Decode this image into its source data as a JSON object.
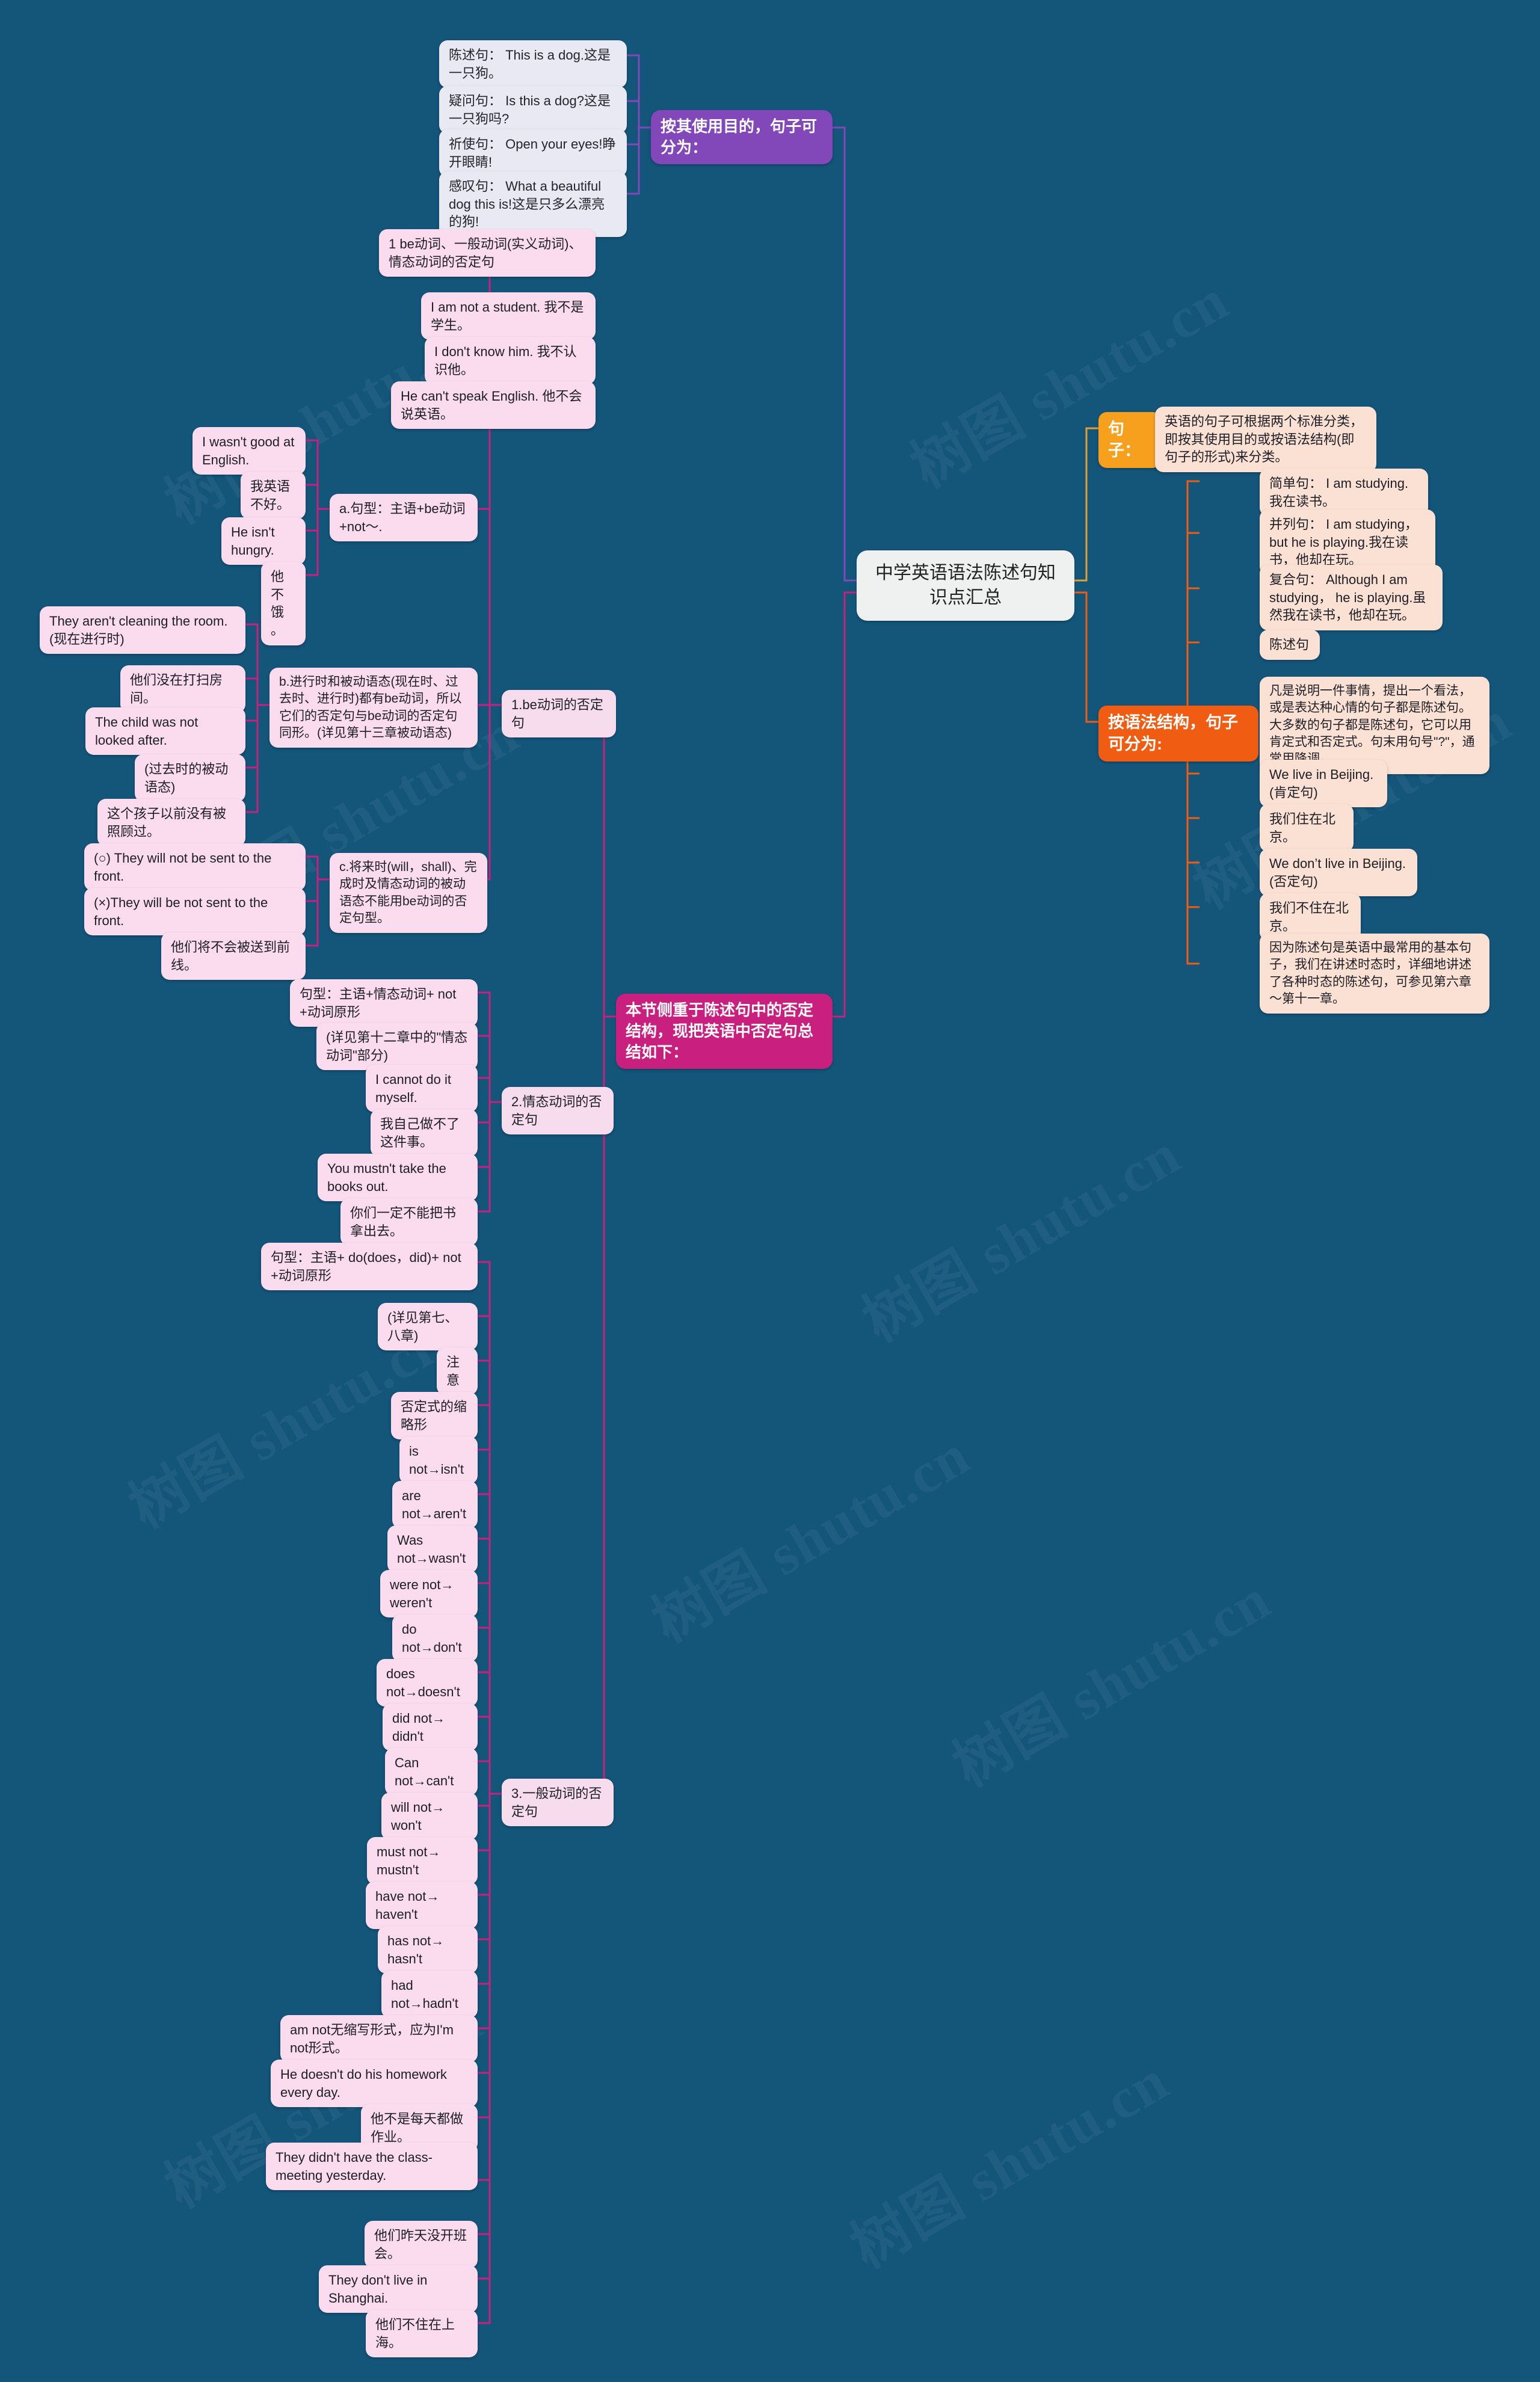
{
  "meta": {
    "watermark": "树图 shutu.cn",
    "background_color": "#14557a"
  },
  "root": {
    "label": "中学英语语法陈述句知识点汇总"
  },
  "branches": {
    "purpose": {
      "label": "按其使用目的，句子可分为：",
      "color": "#8247b8",
      "items": [
        "陈述句：  This is a dog.这是一只狗。",
        "疑问句：  Is this a dog?这是一只狗吗?",
        "祈使句：  Open your eyes!睁开眼睛!",
        "感叹句：  What a beautiful dog this is!这是只多么漂亮的狗!"
      ]
    },
    "negation_intro": {
      "label": "本节侧重于陈述句中的否定结构，现把英语中否定句总结如下：",
      "color": "#c9207f"
    },
    "be_negation": {
      "label": "1.be动词的否定句",
      "color": "#c9207f",
      "head_items": [
        "1 be动词、一般动词(实义动词)、情态动词的否定句",
        "I am not a student. 我不是学生。",
        "I don't know him. 我不认识他。",
        "He can't speak English. 他不会说英语。"
      ],
      "sub_a": {
        "label": "a.句型：主语+be动词+not～.",
        "items": [
          "I wasn't good at English.",
          "我英语不好。",
          "He isn't hungry.",
          "他不饿。"
        ]
      },
      "sub_b": {
        "label": "b.进行时和被动语态(现在时、过去时、进行时)都有be动词，所以它们的否定句与be动词的否定句同形。(详见第十三章被动语态)",
        "items": [
          "They aren't cleaning the room.(现在进行时)",
          "他们没在打扫房间。",
          "The child was not looked after.",
          "(过去时的被动语态)",
          "这个孩子以前没有被照顾过。"
        ]
      },
      "sub_c": {
        "label": "c.将来时(will，shall)、完成时及情态动词的被动语态不能用be动词的否定句型。",
        "items": [
          "(○) They will not be sent to the front.",
          "(×)They will be not sent to the front.",
          "他们将不会被送到前线。"
        ]
      }
    },
    "modal_negation": {
      "label": "2.情态动词的否定句",
      "color": "#c9207f",
      "items": [
        "句型：主语+情态动词+ not +动词原形",
        "(详见第十二章中的\"情态动词\"部分)",
        "I cannot do it myself.",
        "我自己做不了这件事。",
        "You mustn't take the books out.",
        "你们一定不能把书拿出去。"
      ]
    },
    "verb_negation": {
      "label": "3.一般动词的否定句",
      "color": "#c9207f",
      "items": [
        "句型：主语+ do(does，did)+ not +动词原形",
        "(详见第七、八章)",
        "注意",
        "否定式的缩略形",
        "is not→isn't",
        "are not→aren't",
        "Was not→wasn't",
        "were not→ weren't",
        "do not→don't",
        "does not→doesn't",
        "did not→ didn't",
        "Can not→can't",
        "will not→ won't",
        "must not→ mustn't",
        "have not→ haven't",
        "has not→ hasn't",
        "had not→hadn't",
        "am not无缩写形式，应为I'm not形式。",
        "He doesn't do his homework every day.",
        "他不是每天都做作业。",
        "They didn't have the class-meeting yesterday.",
        "他们昨天没开班会。",
        "They don't live in Shanghai.",
        "他们不住在上海。"
      ]
    },
    "sentence": {
      "label": "句子：",
      "color": "#f6a01e",
      "definition": "英语的句子可根据两个标准分类，即按其使用目的或按语法结构(即句子的形式)来分类。"
    },
    "grammar_structure": {
      "label": "按语法结构，句子可分为:",
      "color": "#ef5c12",
      "items": [
        "简单句：  I am studying.我在读书。",
        "并列句：  I am studying， but he is playing.我在读书，他却在玩。",
        "复合句：  Although I am studying， he is playing.虽然我在读书，他却在玩。",
        "陈述句",
        "凡是说明一件事情，提出一个看法，或是表达种心情的句子都是陈述句。大多数的句子都是陈述句，它可以用肯定式和否定式。句末用句号\"?\"，通常用降调。",
        "We live in Beijing.(肯定句)",
        "我们住在北京。",
        "We don’t live in Beijing.(否定句)",
        "我们不住在北京。",
        "因为陈述句是英语中最常用的基本句子，我们在讲述时态时，详细地讲述了各种时态的陈述句，可参见第六章～第十一章。"
      ]
    }
  }
}
